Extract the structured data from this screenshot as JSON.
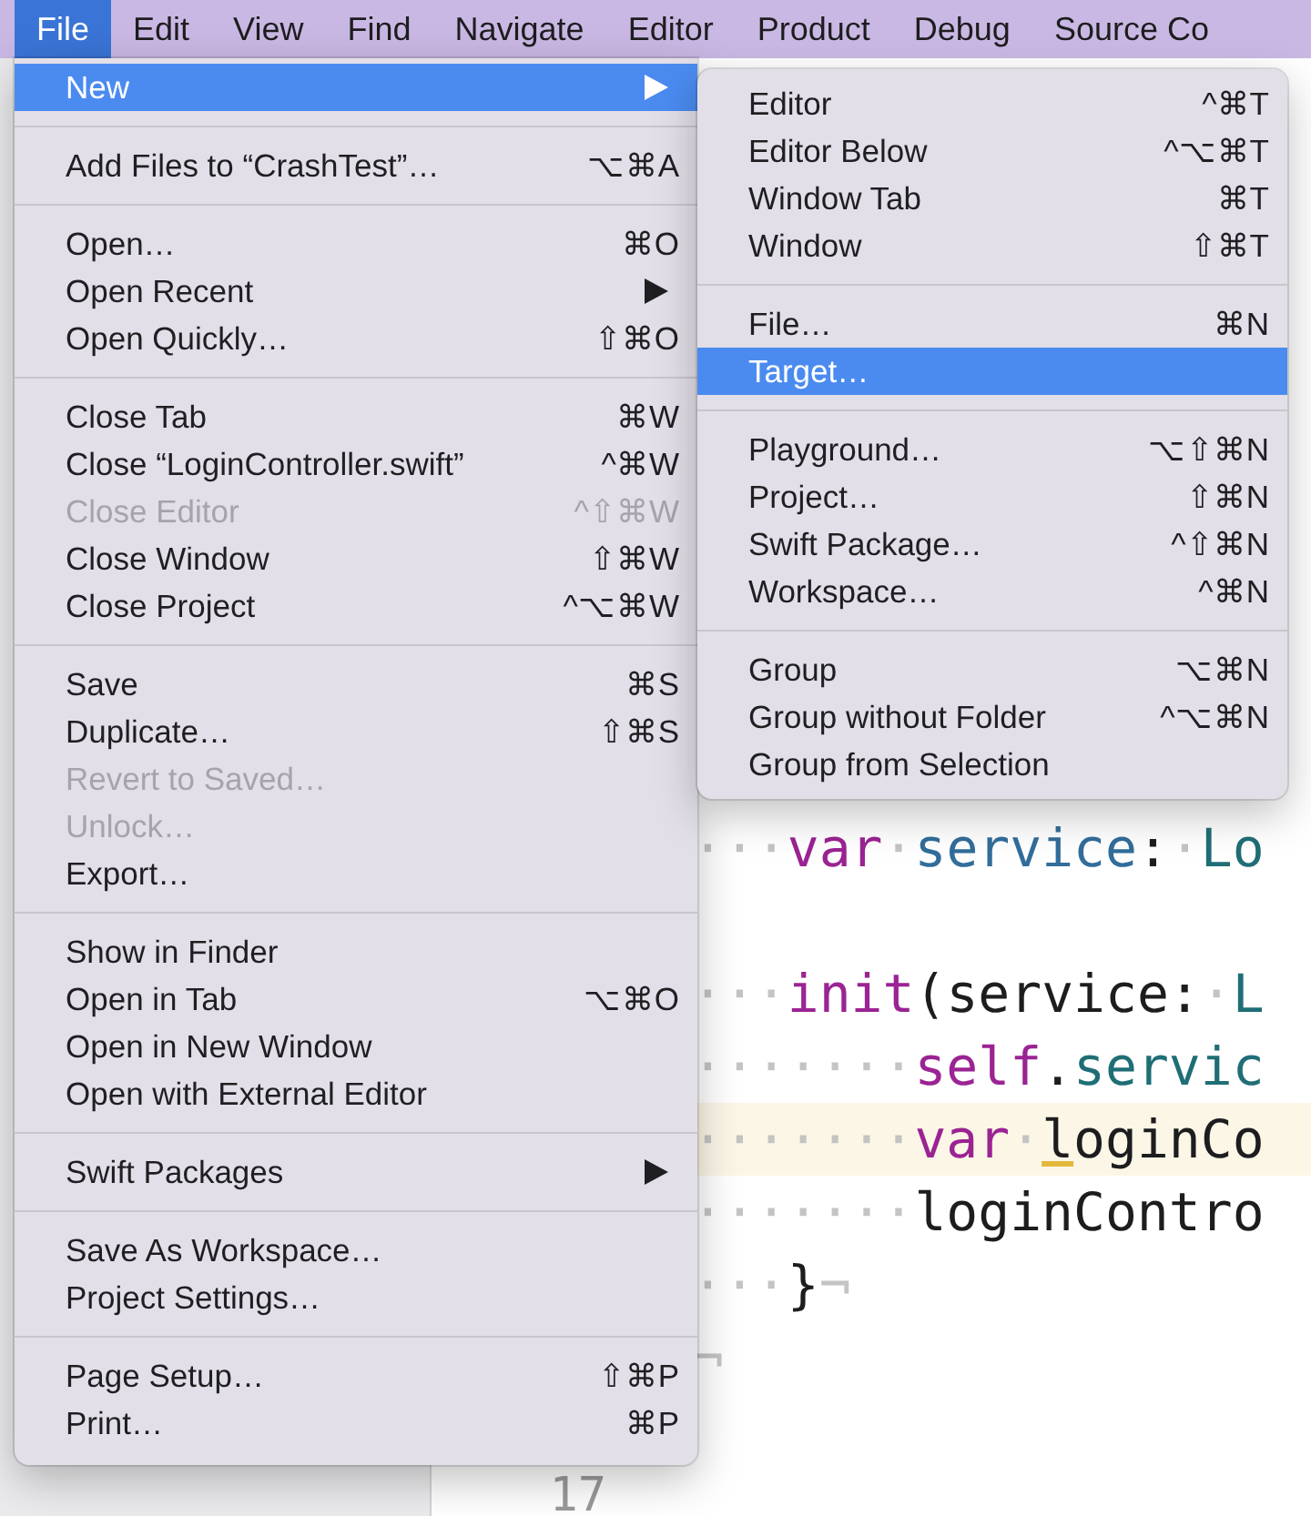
{
  "menu_bar": {
    "items": [
      {
        "label": "File",
        "selected": true
      },
      {
        "label": "Edit",
        "selected": false
      },
      {
        "label": "View",
        "selected": false
      },
      {
        "label": "Find",
        "selected": false
      },
      {
        "label": "Navigate",
        "selected": false
      },
      {
        "label": "Editor",
        "selected": false
      },
      {
        "label": "Product",
        "selected": false
      },
      {
        "label": "Debug",
        "selected": false
      },
      {
        "label": "Source Co",
        "selected": false
      }
    ]
  },
  "editor": {
    "lines": [
      {
        "tokens": [
          {
            "kind": "ws",
            "text": "···"
          },
          {
            "kind": "keyword",
            "text": "var"
          },
          {
            "kind": "ws",
            "text": "·"
          },
          {
            "kind": "property",
            "text": "service"
          },
          {
            "kind": "plain",
            "text": ":"
          },
          {
            "kind": "ws",
            "text": "·"
          },
          {
            "kind": "type",
            "text": "Lo"
          }
        ],
        "current": false
      },
      {
        "current": false
      },
      {
        "tokens": [
          {
            "kind": "ws",
            "text": "···"
          },
          {
            "kind": "keyword",
            "text": "init"
          },
          {
            "kind": "plain",
            "text": "(service:"
          },
          {
            "kind": "ws",
            "text": "·"
          },
          {
            "kind": "type",
            "text": "L"
          }
        ],
        "current": false
      },
      {
        "tokens": [
          {
            "kind": "ws",
            "text": "·······"
          },
          {
            "kind": "keyword",
            "text": "self"
          },
          {
            "kind": "plain",
            "text": "."
          },
          {
            "kind": "type",
            "text": "servic"
          }
        ],
        "current": false
      },
      {
        "tokens": [
          {
            "kind": "ws",
            "text": "·······"
          },
          {
            "kind": "keyword",
            "text": "var"
          },
          {
            "kind": "ws",
            "text": "·"
          },
          {
            "kind": "warning",
            "text": "l"
          },
          {
            "kind": "plain",
            "text": "oginCo"
          }
        ],
        "current": true
      },
      {
        "tokens": [
          {
            "kind": "ws",
            "text": "·······"
          },
          {
            "kind": "plain",
            "text": "loginContro"
          }
        ],
        "current": false
      },
      {
        "tokens": [
          {
            "kind": "ws",
            "text": "···"
          },
          {
            "kind": "plain",
            "text": "}"
          },
          {
            "kind": "ws",
            "text": "¬"
          }
        ],
        "current": false
      },
      {
        "tokens": [
          {
            "kind": "ws",
            "text": "¬"
          }
        ],
        "current": false
      },
      {
        "current": false
      },
      {
        "number": "17",
        "current": false
      }
    ]
  },
  "file_menu": {
    "items": [
      {
        "kind": "item",
        "label": "New",
        "has_submenu": true,
        "selected": true,
        "disabled": false
      },
      {
        "kind": "separator"
      },
      {
        "kind": "item",
        "label": "Add Files to “CrashTest”…",
        "shortcut": "⌥⌘A",
        "selected": false,
        "disabled": false
      },
      {
        "kind": "separator"
      },
      {
        "kind": "item",
        "label": "Open…",
        "shortcut": "⌘O",
        "selected": false,
        "disabled": false
      },
      {
        "kind": "item",
        "label": "Open Recent",
        "has_submenu": true,
        "selected": false,
        "disabled": false
      },
      {
        "kind": "item",
        "label": "Open Quickly…",
        "shortcut": "⇧⌘O",
        "selected": false,
        "disabled": false
      },
      {
        "kind": "separator"
      },
      {
        "kind": "item",
        "label": "Close Tab",
        "shortcut": "⌘W",
        "selected": false,
        "disabled": false
      },
      {
        "kind": "item",
        "label": "Close “LoginController.swift”",
        "shortcut": "^⌘W",
        "selected": false,
        "disabled": false
      },
      {
        "kind": "item",
        "label": "Close Editor",
        "shortcut": "^⇧⌘W",
        "selected": false,
        "disabled": true
      },
      {
        "kind": "item",
        "label": "Close Window",
        "shortcut": "⇧⌘W",
        "selected": false,
        "disabled": false
      },
      {
        "kind": "item",
        "label": "Close Project",
        "shortcut": "^⌥⌘W",
        "selected": false,
        "disabled": false
      },
      {
        "kind": "separator"
      },
      {
        "kind": "item",
        "label": "Save",
        "shortcut": "⌘S",
        "selected": false,
        "disabled": false
      },
      {
        "kind": "item",
        "label": "Duplicate…",
        "shortcut": "⇧⌘S",
        "selected": false,
        "disabled": false
      },
      {
        "kind": "item",
        "label": "Revert to Saved…",
        "selected": false,
        "disabled": true
      },
      {
        "kind": "item",
        "label": "Unlock…",
        "selected": false,
        "disabled": true
      },
      {
        "kind": "item",
        "label": "Export…",
        "selected": false,
        "disabled": false
      },
      {
        "kind": "separator"
      },
      {
        "kind": "item",
        "label": "Show in Finder",
        "selected": false,
        "disabled": false
      },
      {
        "kind": "item",
        "label": "Open in Tab",
        "shortcut": "⌥⌘O",
        "selected": false,
        "disabled": false
      },
      {
        "kind": "item",
        "label": "Open in New Window",
        "selected": false,
        "disabled": false
      },
      {
        "kind": "item",
        "label": "Open with External Editor",
        "selected": false,
        "disabled": false
      },
      {
        "kind": "separator"
      },
      {
        "kind": "item",
        "label": "Swift Packages",
        "has_submenu": true,
        "selected": false,
        "disabled": false
      },
      {
        "kind": "separator"
      },
      {
        "kind": "item",
        "label": "Save As Workspace…",
        "selected": false,
        "disabled": false
      },
      {
        "kind": "item",
        "label": "Project Settings…",
        "selected": false,
        "disabled": false
      },
      {
        "kind": "separator"
      },
      {
        "kind": "item",
        "label": "Page Setup…",
        "shortcut": "⇧⌘P",
        "selected": false,
        "disabled": false
      },
      {
        "kind": "item",
        "label": "Print…",
        "shortcut": "⌘P",
        "selected": false,
        "disabled": false
      }
    ]
  },
  "new_submenu": {
    "items": [
      {
        "kind": "item",
        "label": "Editor",
        "shortcut": "^⌘T",
        "selected": false,
        "disabled": false
      },
      {
        "kind": "item",
        "label": "Editor Below",
        "shortcut": "^⌥⌘T",
        "selected": false,
        "disabled": false
      },
      {
        "kind": "item",
        "label": "Window Tab",
        "shortcut": "⌘T",
        "selected": false,
        "disabled": false
      },
      {
        "kind": "item",
        "label": "Window",
        "shortcut": "⇧⌘T",
        "selected": false,
        "disabled": false
      },
      {
        "kind": "separator"
      },
      {
        "kind": "item",
        "label": "File…",
        "shortcut": "⌘N",
        "selected": false,
        "disabled": false
      },
      {
        "kind": "item",
        "label": "Target…",
        "selected": true,
        "disabled": false
      },
      {
        "kind": "separator"
      },
      {
        "kind": "item",
        "label": "Playground…",
        "shortcut": "⌥⇧⌘N",
        "selected": false,
        "disabled": false
      },
      {
        "kind": "item",
        "label": "Project…",
        "shortcut": "⇧⌘N",
        "selected": false,
        "disabled": false
      },
      {
        "kind": "item",
        "label": "Swift Package…",
        "shortcut": "^⇧⌘N",
        "selected": false,
        "disabled": false
      },
      {
        "kind": "item",
        "label": "Workspace…",
        "shortcut": "^⌘N",
        "selected": false,
        "disabled": false
      },
      {
        "kind": "separator"
      },
      {
        "kind": "item",
        "label": "Group",
        "shortcut": "⌥⌘N",
        "selected": false,
        "disabled": false
      },
      {
        "kind": "item",
        "label": "Group without Folder",
        "shortcut": "^⌥⌘N",
        "selected": false,
        "disabled": false
      },
      {
        "kind": "item",
        "label": "Group from Selection",
        "selected": false,
        "disabled": false
      }
    ]
  }
}
